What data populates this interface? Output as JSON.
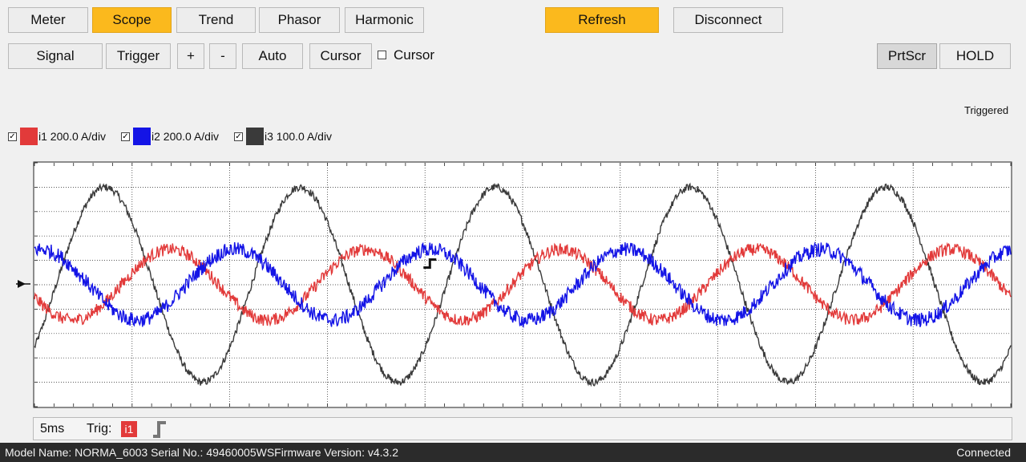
{
  "tabs": [
    {
      "label": "Meter",
      "active": false
    },
    {
      "label": "Scope",
      "active": true
    },
    {
      "label": "Trend",
      "active": false
    },
    {
      "label": "Phasor",
      "active": false
    },
    {
      "label": "Harmonic",
      "active": false
    }
  ],
  "actions": {
    "refresh_label": "Refresh",
    "disconnect_label": "Disconnect"
  },
  "toolbar": {
    "signal": "Signal",
    "trigger": "Trigger",
    "plus": "+",
    "minus": "-",
    "auto": "Auto",
    "cursor": "Cursor",
    "cursor_checkbox_label": "Cursor",
    "cursor_checked": false,
    "prtscr": "PrtScr",
    "hold": "HOLD"
  },
  "trigger_status": "Triggered",
  "channels": [
    {
      "label": "i1 200.0 A/div",
      "color": "#e23a3a",
      "checked": true
    },
    {
      "label": "i2 200.0 A/div",
      "color": "#1414e6",
      "checked": true
    },
    {
      "label": "i3 100.0 A/div",
      "color": "#3a3a3a",
      "checked": true
    }
  ],
  "scope_footer": {
    "timebase": "5ms",
    "trig_label": "Trig:",
    "trig_channel": "i1",
    "trig_slope_icon": "rising-edge-icon"
  },
  "status_bar": {
    "model": "Model Name:  NORMA_6003 Serial No.:  49460005WSFirmware Version:  v4.3.2",
    "connection": "Connected"
  },
  "chart_data": {
    "type": "line",
    "xlabel": "",
    "ylabel": "",
    "x_divisions": 10,
    "y_divisions": 10,
    "grid": true,
    "series": [
      {
        "name": "i1",
        "color": "#e23a3a",
        "cycles_in_window": 5,
        "phase_deg": 200,
        "amplitude_div": 1.45,
        "noise": 0.25
      },
      {
        "name": "i2",
        "color": "#1414e6",
        "cycles_in_window": 5,
        "phase_deg": 80,
        "amplitude_div": 1.45,
        "noise": 0.3
      },
      {
        "name": "i3",
        "color": "#3a3a3a",
        "cycles_in_window": 5,
        "phase_deg": 320,
        "amplitude_div": 4.0,
        "noise": 0.15
      }
    ]
  }
}
